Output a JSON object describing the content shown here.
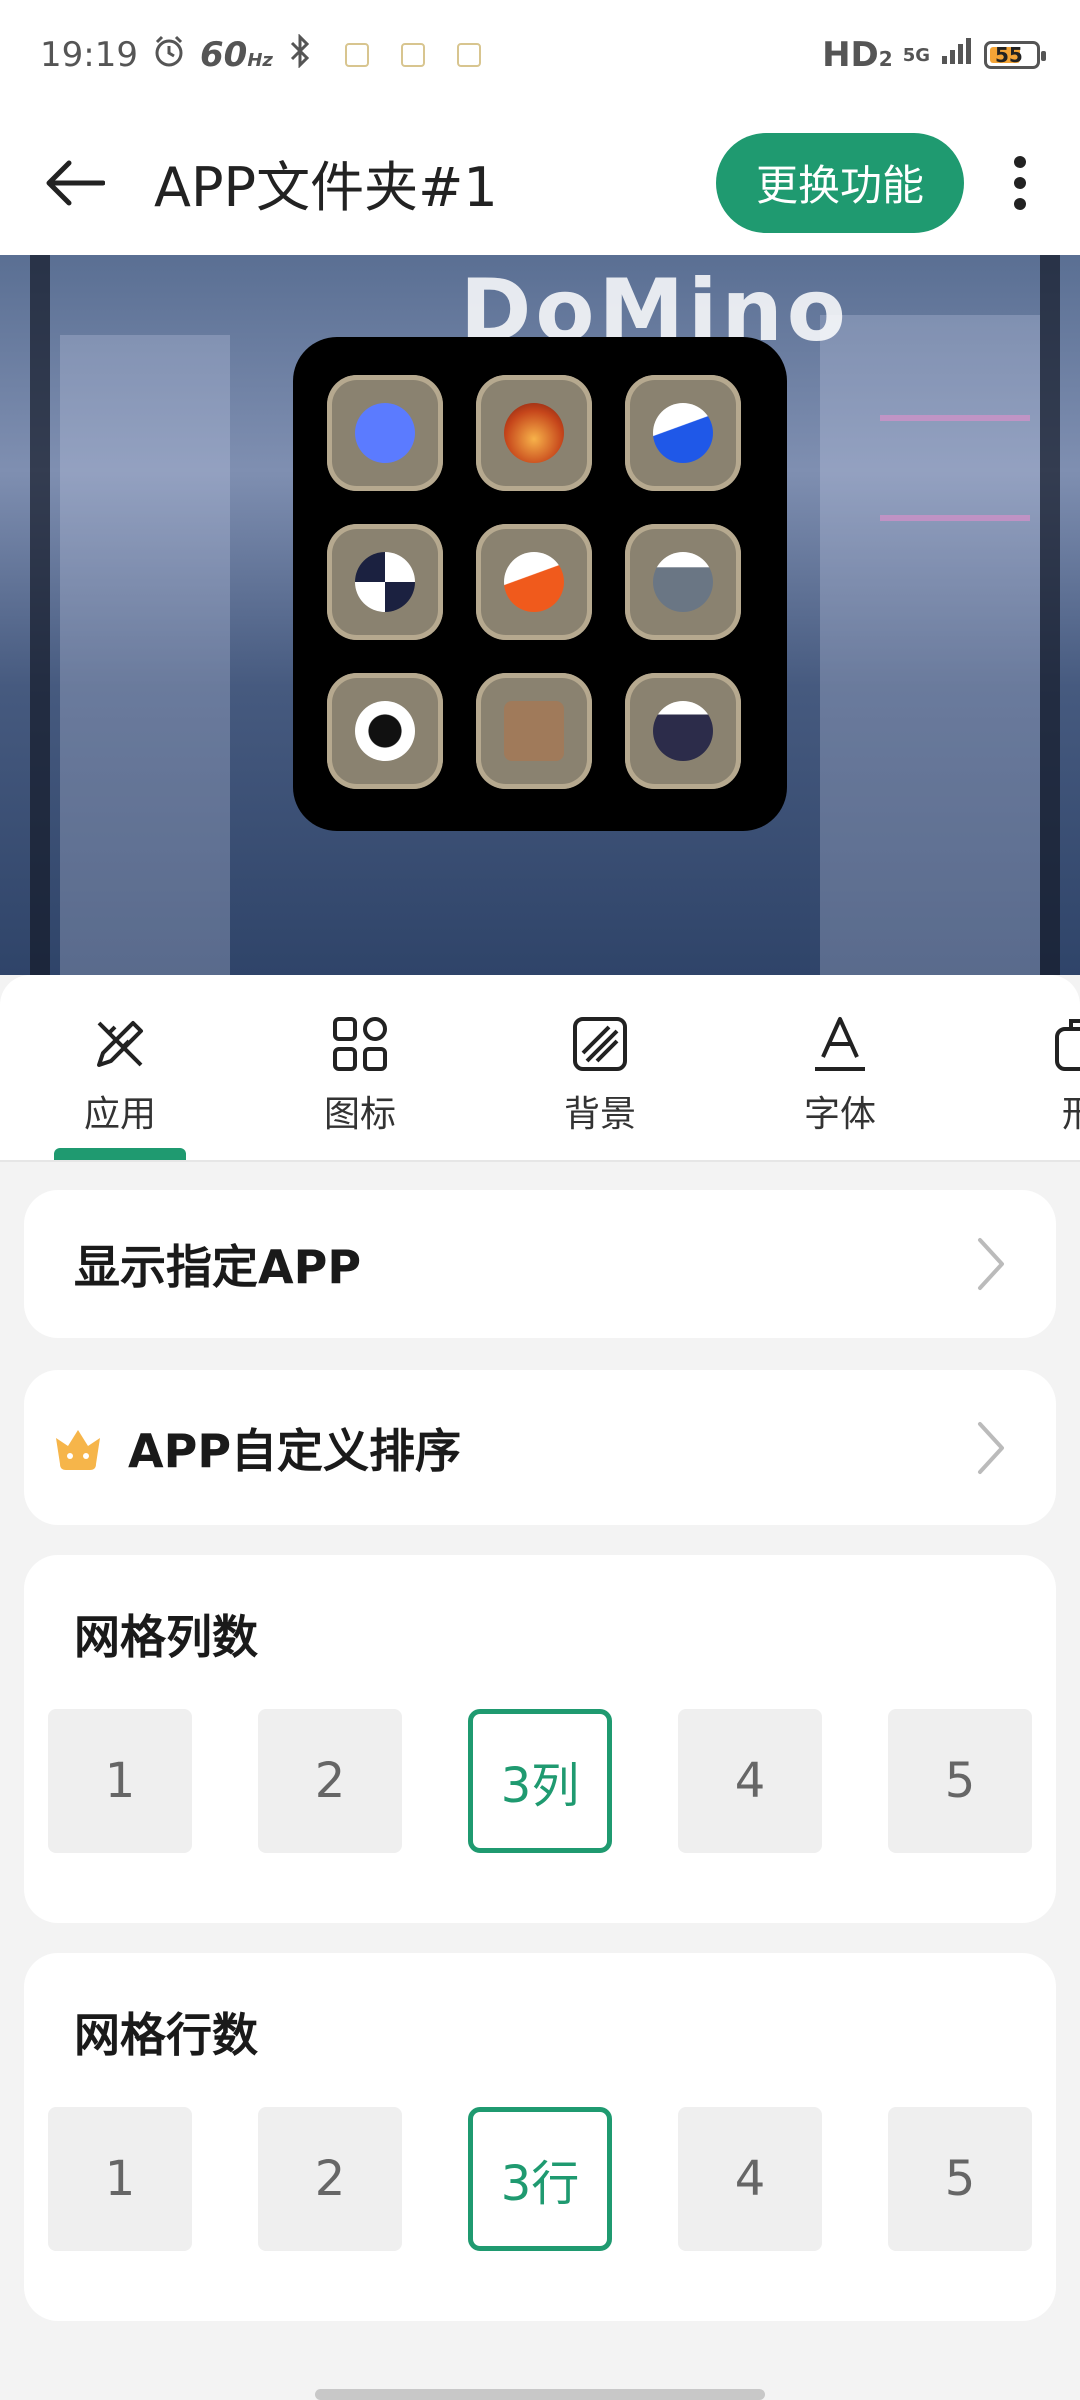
{
  "status_bar": {
    "time": "19:19",
    "refresh_rate": "60",
    "refresh_unit": "Hz",
    "network_hd": "HD",
    "network_hd_sub": "2",
    "network_gen": "5G",
    "battery_level": "55",
    "battery_color": "#f4a436"
  },
  "app_bar": {
    "title": "APP文件夹#1",
    "switch_label": "更换功能",
    "back_icon": "arrow-left-icon",
    "more_icon": "more-vertical-icon"
  },
  "preview": {
    "background_sign": "DoMino",
    "folder_icons": [
      {
        "name": "app-icon-1",
        "glyph_color": "#5b7bff"
      },
      {
        "name": "app-icon-2",
        "glyph_color": "#c6461b"
      },
      {
        "name": "app-icon-3",
        "glyph_color": "#1f58e8"
      },
      {
        "name": "app-icon-4",
        "glyph_color": "#1b2140"
      },
      {
        "name": "app-icon-5",
        "glyph_color": "#f05a1c"
      },
      {
        "name": "app-icon-6",
        "glyph_color": "#6a7684"
      },
      {
        "name": "app-icon-7",
        "glyph_color": "#111111"
      },
      {
        "name": "app-icon-8",
        "glyph_color": "#a07a5a"
      },
      {
        "name": "app-icon-9",
        "glyph_color": "#2c2c4a"
      }
    ]
  },
  "tabs": [
    {
      "label": "应用",
      "icon": "pen-ruler-icon",
      "active": true
    },
    {
      "label": "图标",
      "icon": "grid-icon",
      "active": false
    },
    {
      "label": "背景",
      "icon": "stripes-icon",
      "active": false
    },
    {
      "label": "字体",
      "icon": "font-icon",
      "active": false
    },
    {
      "label": "形",
      "icon": "shape-icon",
      "active": false
    }
  ],
  "settings": {
    "show_app_label": "显示指定APP",
    "custom_sort_label": "APP自定义排序",
    "columns_title": "网格列数",
    "columns_options": [
      "1",
      "2",
      "3列",
      "4",
      "5"
    ],
    "columns_selected": "3列",
    "rows_title": "网格行数",
    "rows_options": [
      "1",
      "2",
      "3行",
      "4",
      "5"
    ],
    "rows_selected": "3行"
  },
  "colors": {
    "accent": "#1f9a70",
    "crown": "#f6b54a"
  }
}
